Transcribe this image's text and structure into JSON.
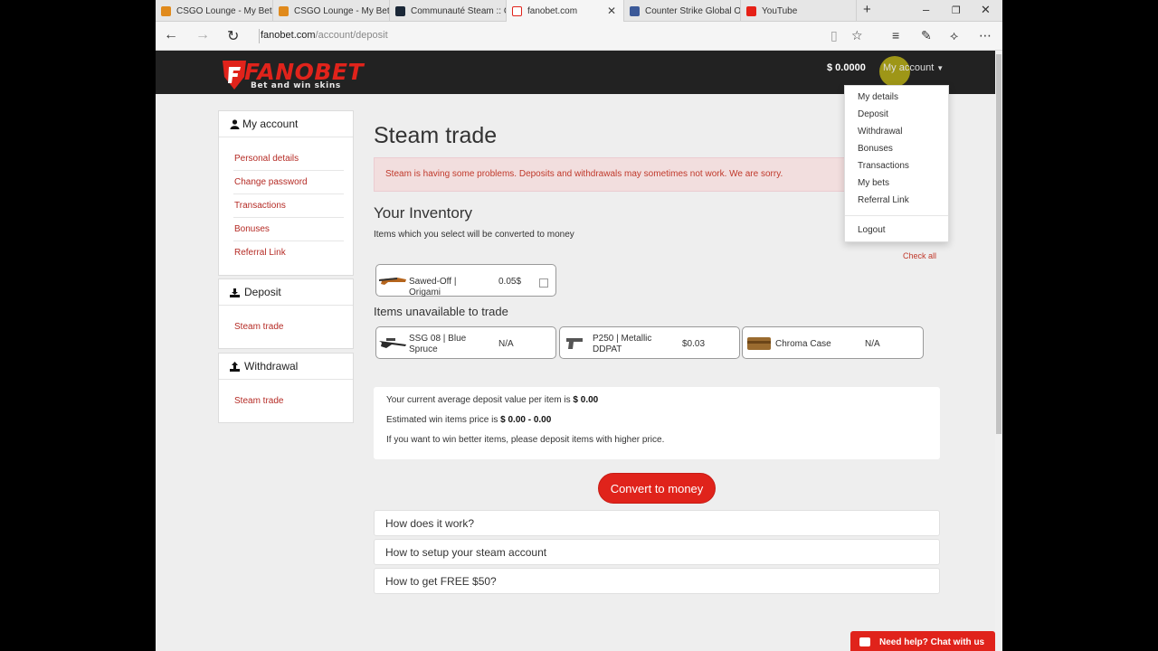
{
  "browser": {
    "tabs": [
      {
        "title": "CSGO Lounge - My Bets",
        "favicon": "csgolounge-icon"
      },
      {
        "title": "CSGO Lounge - My Bets",
        "favicon": "csgolounge-icon"
      },
      {
        "title": "Communauté Steam :: G",
        "favicon": "steam-icon"
      },
      {
        "title": "fanobet.com",
        "favicon": "fanobet-icon",
        "active": true
      },
      {
        "title": "Counter Strike Global Of",
        "favicon": "facebook-icon"
      },
      {
        "title": "YouTube",
        "favicon": "youtube-icon"
      }
    ],
    "new_tab_label": "+",
    "url_domain": "fanobet.com",
    "url_path": "/account/deposit"
  },
  "header": {
    "logo_text": "FANOBET",
    "logo_tagline": "Bet and win skins",
    "balance": "$ 0.0000",
    "my_account_label": "My account"
  },
  "dropdown": {
    "items": [
      "My details",
      "Deposit",
      "Withdrawal",
      "Bonuses",
      "Transactions",
      "My bets",
      "Referral Link"
    ],
    "logout": "Logout"
  },
  "sidebar": {
    "my_account": {
      "title": "My account",
      "links": [
        "Personal details",
        "Change password",
        "Transactions",
        "Bonuses",
        "Referral Link"
      ]
    },
    "deposit": {
      "title": "Deposit",
      "links": [
        "Steam trade"
      ]
    },
    "withdrawal": {
      "title": "Withdrawal",
      "links": [
        "Steam trade"
      ]
    }
  },
  "main": {
    "title": "Steam trade",
    "alert": "Steam is having some problems. Deposits and withdrawals may sometimes not work. We are sorry.",
    "inventory_title": "Your Inventory",
    "inventory_subtitle": "Items which you select will be converted to money",
    "check_all": "Check all",
    "inventory_items": [
      {
        "name": "Sawed-Off | Origami",
        "price": "0.05$"
      }
    ],
    "unavailable_title": "Items unavailable to trade",
    "unavailable_items": [
      {
        "name": "SSG 08 | Blue Spruce",
        "price": "N/A"
      },
      {
        "name": "P250 | Metallic DDPAT",
        "price": "$0.03"
      },
      {
        "name": "Chroma Case",
        "price": "N/A"
      }
    ],
    "info": {
      "line1_prefix": "Your current average deposit value per item is ",
      "line1_value": "$ 0.00",
      "line2_prefix": "Estimated win items price is ",
      "line2_value": "$ 0.00 - 0.00",
      "line3": "If you want to win better items, please deposit items with higher price."
    },
    "convert_button": "Convert to money",
    "faq": [
      "How does it work?",
      "How to setup your steam account",
      "How to get FREE $50?"
    ]
  },
  "chat": {
    "label": "Need help? Chat with us"
  },
  "colors": {
    "brand_red": "#e0231b",
    "header_bg": "#222222",
    "link_red": "#b52b25"
  }
}
